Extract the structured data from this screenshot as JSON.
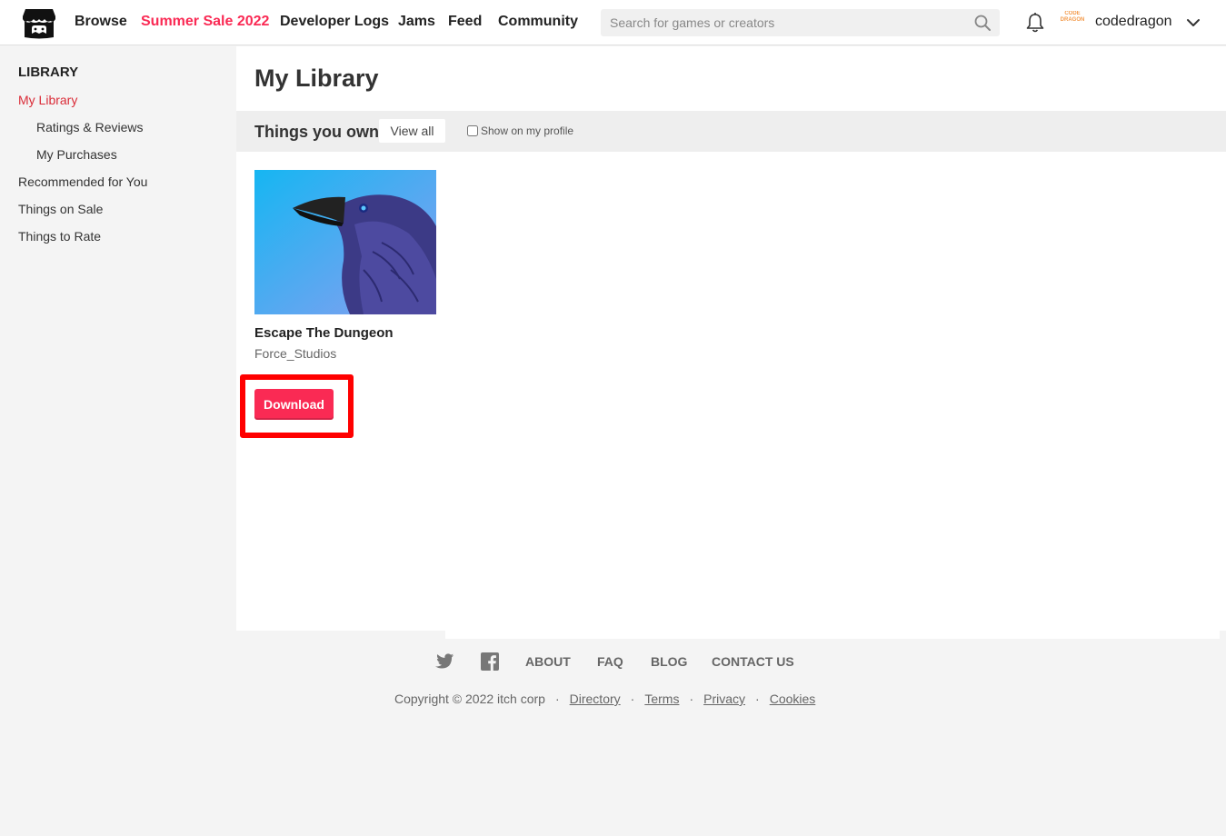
{
  "header": {
    "nav": [
      "Browse",
      "Summer Sale 2022",
      "Developer Logs",
      "Jams",
      "Feed",
      "Community"
    ],
    "search_placeholder": "Search for games or creators",
    "avatar_text": "CODE DRAGON",
    "username": "codedragon",
    "sale_color": "#fa2a54"
  },
  "sidebar": {
    "heading": "LIBRARY",
    "items": [
      {
        "label": "My Library",
        "active": true
      },
      {
        "label": "Ratings & Reviews"
      },
      {
        "label": "My Purchases"
      },
      {
        "label": "Recommended for You"
      },
      {
        "label": "Things on Sale"
      },
      {
        "label": "Things to Rate"
      }
    ]
  },
  "main": {
    "title": "My Library",
    "section_title": "Things you own",
    "view_all": "View all",
    "show_on_profile": "Show on my profile",
    "games": [
      {
        "title": "Escape The Dungeon",
        "author": "Force_Studios",
        "download_label": "Download"
      }
    ]
  },
  "footer": {
    "links": [
      "ABOUT",
      "FAQ",
      "BLOG",
      "CONTACT US"
    ],
    "icons": [
      "twitter-icon",
      "facebook-icon"
    ],
    "copyright": "Copyright © 2022 itch corp",
    "bottom_links": [
      "Directory",
      "Terms",
      "Privacy",
      "Cookies"
    ],
    "separator": "·"
  },
  "colors": {
    "accent": "#fa2a54",
    "active_link": "#da2c38",
    "highlight": "#ff0000"
  }
}
